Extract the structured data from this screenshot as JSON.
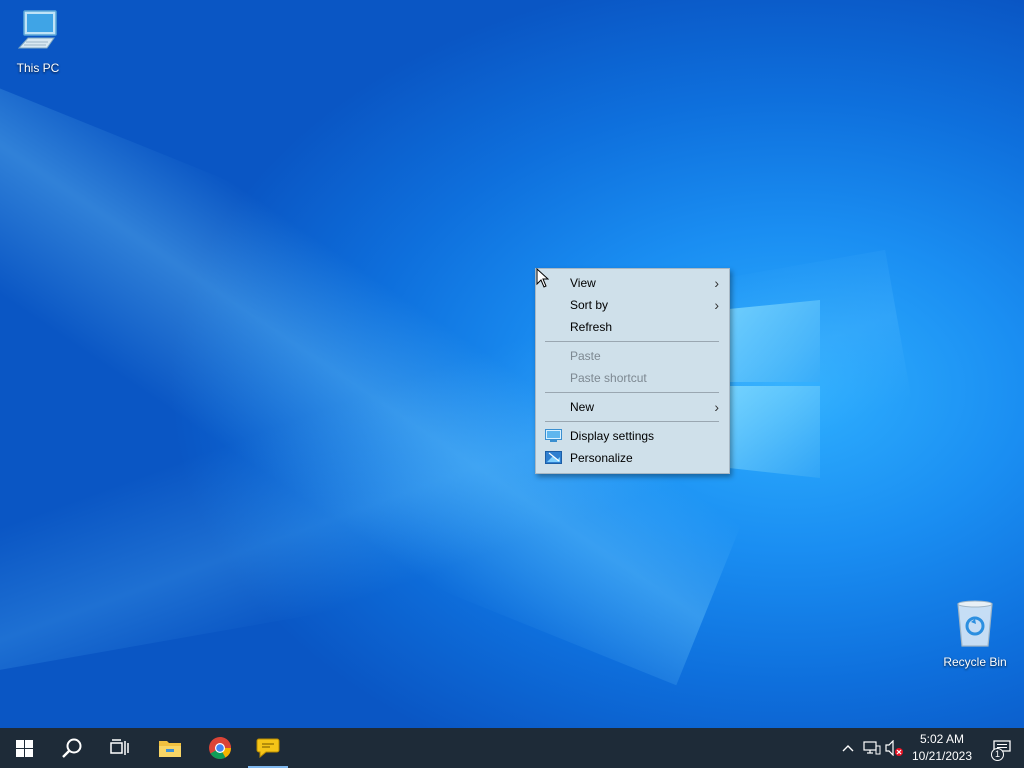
{
  "desktop": {
    "icons": [
      {
        "label": "This PC",
        "icon": "computer-icon"
      },
      {
        "label": "Recycle Bin",
        "icon": "recycle-bin-icon"
      }
    ]
  },
  "context_menu": {
    "items": [
      {
        "label": "View",
        "has_submenu": true,
        "enabled": true
      },
      {
        "label": "Sort by",
        "has_submenu": true,
        "enabled": true
      },
      {
        "label": "Refresh",
        "has_submenu": false,
        "enabled": true
      },
      {
        "label": "Paste",
        "has_submenu": false,
        "enabled": false
      },
      {
        "label": "Paste shortcut",
        "has_submenu": false,
        "enabled": false
      },
      {
        "label": "New",
        "has_submenu": true,
        "enabled": true
      },
      {
        "label": "Display settings",
        "has_submenu": false,
        "enabled": true,
        "icon": "display-icon"
      },
      {
        "label": "Personalize",
        "has_submenu": false,
        "enabled": true,
        "icon": "personalize-icon"
      }
    ],
    "submenu_arrow": "›"
  },
  "taskbar": {
    "buttons": [
      {
        "icon": "windows-start-icon"
      },
      {
        "icon": "search-icon"
      },
      {
        "icon": "task-view-icon"
      },
      {
        "icon": "file-explorer-icon"
      },
      {
        "icon": "chrome-icon"
      },
      {
        "icon": "chat-app-icon",
        "active": true
      }
    ],
    "tray": {
      "chevron": "^",
      "time": "5:02 AM",
      "date": "10/21/2023",
      "notification_count": "1"
    }
  },
  "colors": {
    "taskbar_bg": "#1e2b38",
    "menu_bg": "#cfe0ea",
    "accent": "#0e6fdc"
  }
}
